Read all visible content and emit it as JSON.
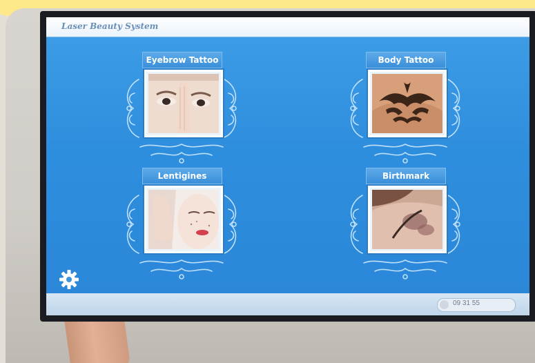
{
  "window": {
    "app_title": "Laser Beauty System"
  },
  "tiles": [
    {
      "label": "Eyebrow Tattoo",
      "icon": "face-eyebrow-photo"
    },
    {
      "label": "Body Tattoo",
      "icon": "tribal-tattoo-photo"
    },
    {
      "label": "Lentigines",
      "icon": "face-lentigines-photo"
    },
    {
      "label": "Birthmark",
      "icon": "shoulder-birthmark-photo"
    }
  ],
  "footer": {
    "clock": "09  31  55",
    "settings_icon": "gear-icon"
  },
  "colors": {
    "screen_background": "#2e8ede",
    "label_background": "#3a8fd9",
    "title_text": "#6a8fb8",
    "frame_border": "#ffffff",
    "banner_yellow": "#fde989"
  }
}
